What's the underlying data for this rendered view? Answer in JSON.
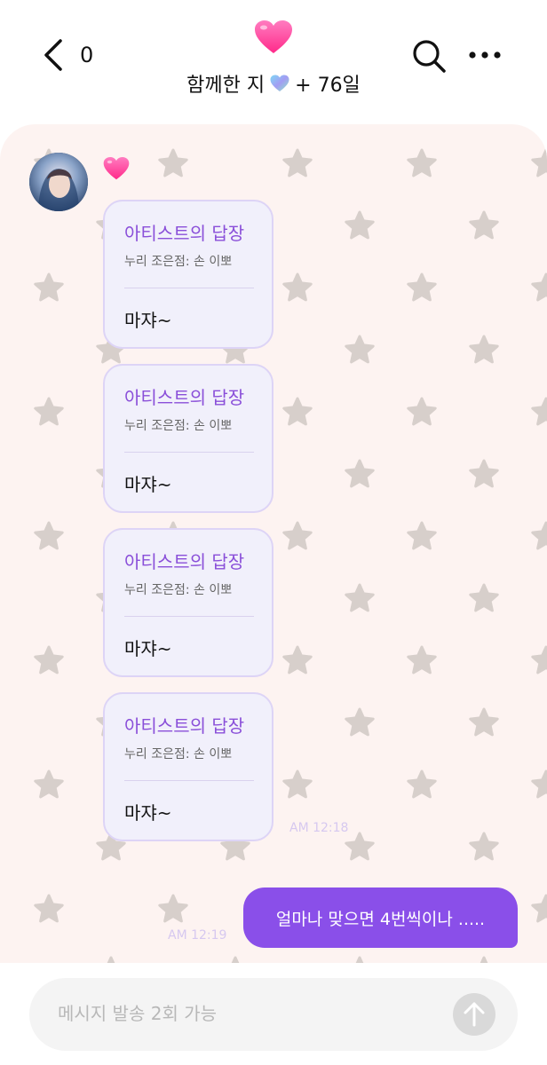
{
  "header": {
    "unread_count": "0",
    "together_prefix": "함께한 지",
    "together_suffix": "+ 76일"
  },
  "messages": {
    "artist_replies": [
      {
        "title": "아티스트의 답장",
        "quote": "누리 조은점: 손 이뽀",
        "body": "마쟈~"
      },
      {
        "title": "아티스트의 답장",
        "quote": "누리 조은점: 손 이뽀",
        "body": "마쟈~"
      },
      {
        "title": "아티스트의 답장",
        "quote": "누리 조은점: 손 이뽀",
        "body": "마쟈~"
      },
      {
        "title": "아티스트의 답장",
        "quote": "누리 조은점: 손 이뽀",
        "body": "마쟈~"
      }
    ],
    "artist_time": "AM 12:18",
    "my_message": "얼마나 맞으면 4번씩이나 .....",
    "my_time": "AM 12:19"
  },
  "input": {
    "placeholder": "메시지 발송 2회 가능"
  },
  "colors": {
    "accent": "#8a4fe9",
    "chat_background": "#fdf3f1",
    "star": "#d7cfcb",
    "heart": "#ff3d9a"
  }
}
